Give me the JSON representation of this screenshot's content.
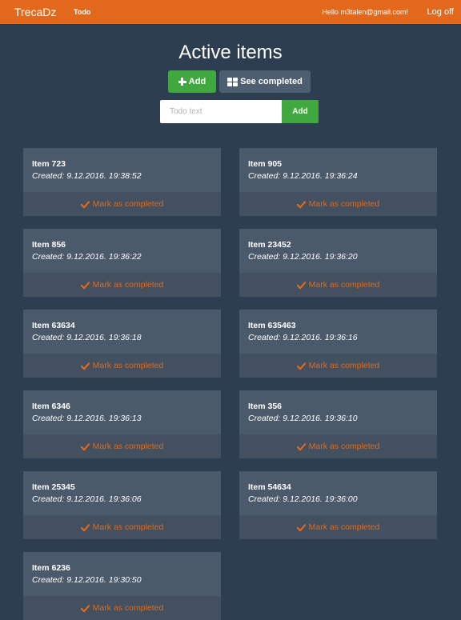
{
  "navbar": {
    "brand": "TrecaDz",
    "todo_link": "Todo",
    "greeting": "Hello m3talen@gmail.com!",
    "logoff": "Log off"
  },
  "main": {
    "title": "Active items",
    "add_button": "Add",
    "see_completed_button": "See completed",
    "todo_input_placeholder": "Todo text",
    "todo_input_value": "",
    "input_add_button": "Add"
  },
  "items": [
    {
      "title": "Item 723",
      "created": "Created: 9.12.2016. 19:38:52",
      "action": "Mark as completed"
    },
    {
      "title": "Item 905",
      "created": "Created: 9.12.2016. 19:36:24",
      "action": "Mark as completed"
    },
    {
      "title": "Item 856",
      "created": "Created: 9.12.2016. 19:36:22",
      "action": "Mark as completed"
    },
    {
      "title": "Item 23452",
      "created": "Created: 9.12.2016. 19:36:20",
      "action": "Mark as completed"
    },
    {
      "title": "Item 63634",
      "created": "Created: 9.12.2016. 19:36:18",
      "action": "Mark as completed"
    },
    {
      "title": "Item 635463",
      "created": "Created: 9.12.2016. 19:36:16",
      "action": "Mark as completed"
    },
    {
      "title": "Item 6346",
      "created": "Created: 9.12.2016. 19:36:13",
      "action": "Mark as completed"
    },
    {
      "title": "Item 356",
      "created": "Created: 9.12.2016. 19:36:10",
      "action": "Mark as completed"
    },
    {
      "title": "Item 25345",
      "created": "Created: 9.12.2016. 19:36:06",
      "action": "Mark as completed"
    },
    {
      "title": "Item 54634",
      "created": "Created: 9.12.2016. 19:36:00",
      "action": "Mark as completed"
    },
    {
      "title": "Item 6236",
      "created": "Created: 9.12.2016. 19:30:50",
      "action": "Mark as completed"
    }
  ],
  "icons": {
    "add": "plus-icon",
    "see_completed": "grid-icon",
    "mark_completed": "check-icon"
  },
  "colors": {
    "navbar": "#e2691c",
    "background": "#2c3e50",
    "add_button": "#3fa83f",
    "secondary_button": "#4c5e70",
    "card_top": "#4b5a6b",
    "card_bottom": "#42505f",
    "accent": "#e2691c"
  }
}
